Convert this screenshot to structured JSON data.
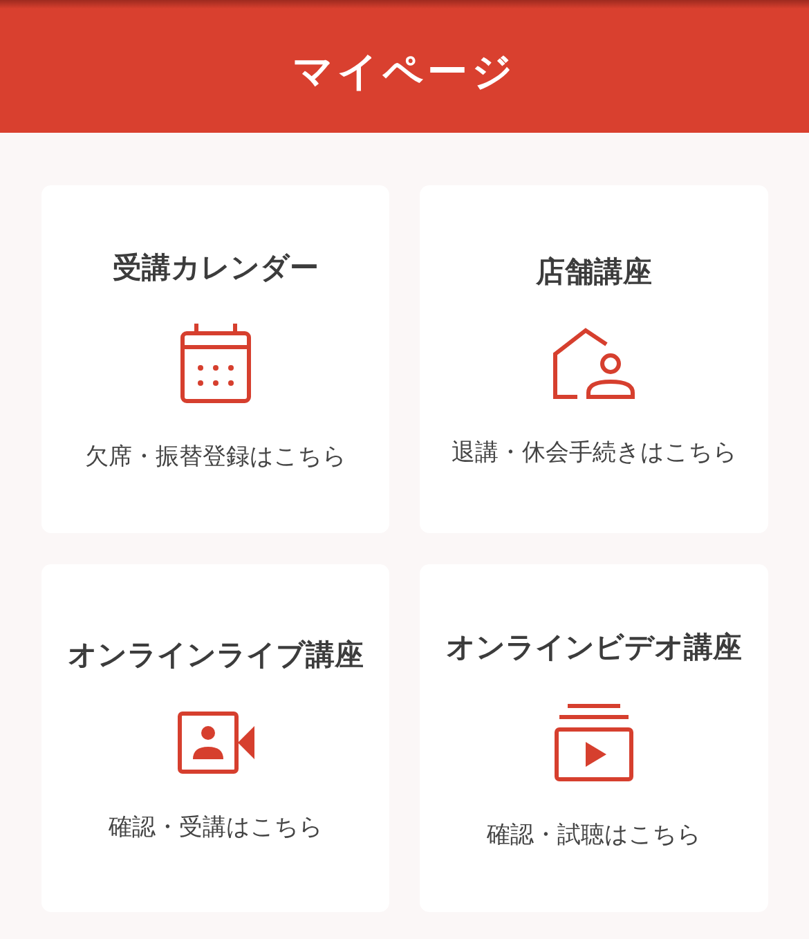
{
  "header": {
    "title": "マイページ"
  },
  "cards": [
    {
      "title": "受講カレンダー",
      "kind": "calendar",
      "caption": "欠席・振替登録はこちら"
    },
    {
      "title": "店舗講座",
      "kind": "store",
      "caption": "退講・休会手続きはこちら"
    },
    {
      "title": "オンラインライブ講座",
      "kind": "live",
      "caption": "確認・受講はこちら"
    },
    {
      "title": "オンラインビデオ講座",
      "kind": "video",
      "caption": "確認・試聴はこちら"
    }
  ]
}
